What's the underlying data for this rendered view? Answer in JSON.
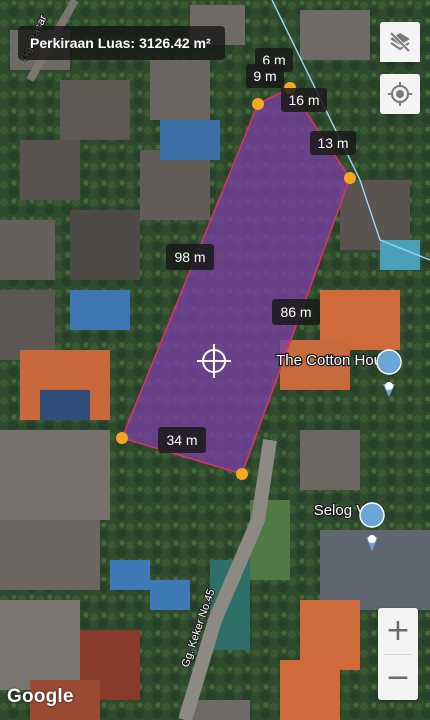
{
  "area": {
    "label": "Perkiraan Luas:",
    "value": "3126.42 m²"
  },
  "segments": [
    {
      "label": "6 m"
    },
    {
      "label": "9 m"
    },
    {
      "label": "16 m"
    },
    {
      "label": "13 m"
    },
    {
      "label": "86 m"
    },
    {
      "label": "34 m"
    },
    {
      "label": "98 m"
    }
  ],
  "places": [
    {
      "name": "The Cotton House"
    },
    {
      "name": "Selog Villa"
    }
  ],
  "streets": [
    {
      "name": "Gg. Keker No.45"
    },
    {
      "name": "Gg. Pasar"
    }
  ],
  "controls": {
    "layers_icon": "layers-off-icon",
    "locate_icon": "my-location-icon",
    "zoom_in": "+",
    "zoom_out": "−"
  },
  "attribution": "Google",
  "colors": {
    "polygon_fill": "#7a3fa3",
    "polygon_stroke": "#e0335a",
    "vertex": "#f5a623",
    "label_bg": "#1a1a1a",
    "place_pin": "#6aa6d6"
  }
}
